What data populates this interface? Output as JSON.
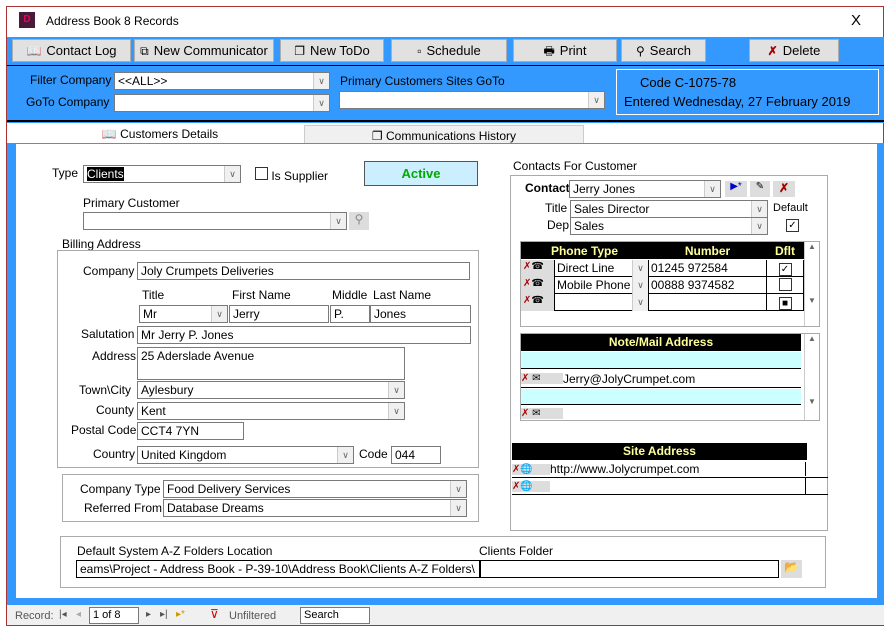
{
  "window": {
    "title": "Address Book 8 Records",
    "close": "X"
  },
  "toolbar": [
    {
      "label": "Contact Log",
      "icon": "book-icon"
    },
    {
      "label": "New Communicator",
      "icon": "network-icon"
    },
    {
      "label": "New ToDo",
      "icon": "pages-icon"
    },
    {
      "label": "Schedule",
      "icon": "calendar-icon"
    },
    {
      "label": "Print",
      "icon": "printer-icon"
    },
    {
      "label": "Search",
      "icon": "binoculars-icon"
    },
    {
      "label": "Delete",
      "icon": "delete-icon"
    }
  ],
  "filters": {
    "filter_company_label": "Filter Company",
    "filter_company_value": "<<ALL>>",
    "goto_company_label": "GoTo Company",
    "goto_company_value": "",
    "primary_sites_label": "Primary Customers Sites GoTo",
    "primary_sites_value": ""
  },
  "record_info": {
    "code_label": "Code",
    "code": "C-1075-78",
    "entered_label": "Entered",
    "entered": "Wednesday, 27 February 2019"
  },
  "tabs": [
    "Customers Details",
    "Communications History"
  ],
  "customer": {
    "type_label": "Type",
    "type": "Clients",
    "is_supplier_label": "Is Supplier",
    "status": "Active",
    "primary_customer_label": "Primary Customer",
    "primary_customer": ""
  },
  "billing": {
    "section": "Billing Address",
    "company_label": "Company",
    "company": "Joly Crumpets Deliveries",
    "title_label": "Title",
    "first_label": "First Name",
    "middle_label": "Middle",
    "last_label": "Last Name",
    "title": "Mr",
    "first": "Jerry",
    "middle": "P.",
    "last": "Jones",
    "salutation_label": "Salutation",
    "salutation": "Mr Jerry P. Jones",
    "address_label": "Address",
    "address": "25 Aderslade Avenue",
    "town_label": "Town\\City",
    "town": "Aylesbury",
    "county_label": "County",
    "county": "Kent",
    "postcode_label": "Postal Code",
    "postcode": "CCT4 7YN",
    "country_label": "Country",
    "country": "United Kingdom",
    "code_label": "Code",
    "code": "044"
  },
  "company_type": {
    "label": "Company Type",
    "value": "Food Delivery Services",
    "referred_label": "Referred From",
    "referred": "Database Dreams"
  },
  "contacts": {
    "section": "Contacts For Customer",
    "contact_label": "Contact",
    "contact": "Jerry Jones",
    "title_label": "Title",
    "title": "Sales Director",
    "dep_label": "Dep",
    "dep": "Sales",
    "default_label": "Default",
    "phone_headers": [
      "Phone Type",
      "Number",
      "Dflt"
    ],
    "phones": [
      {
        "type": "Direct Line",
        "number": "01245 972584",
        "dflt": "✓"
      },
      {
        "type": "Mobile Phone",
        "number": "00888 9374582",
        "dflt": ""
      },
      {
        "type": "",
        "number": "",
        "dflt": "■"
      }
    ],
    "note_header": "Note/Mail Address",
    "notes": [
      "Jerry@JolyCrumpet.com",
      ""
    ],
    "site_header": "Site Address",
    "sites": [
      "http://www.Jolycrumpet.com",
      ""
    ]
  },
  "folders": {
    "default_label": "Default System A-Z Folders Location",
    "default_value": "eams\\Project - Address Book - P-39-10\\Address Book\\Clients A-Z Folders\\",
    "clients_label": "Clients Folder",
    "clients_value": ""
  },
  "statusbar": {
    "record_label": "Record:",
    "position": "1 of 8",
    "filter": "Unfiltered",
    "search": "Search"
  }
}
